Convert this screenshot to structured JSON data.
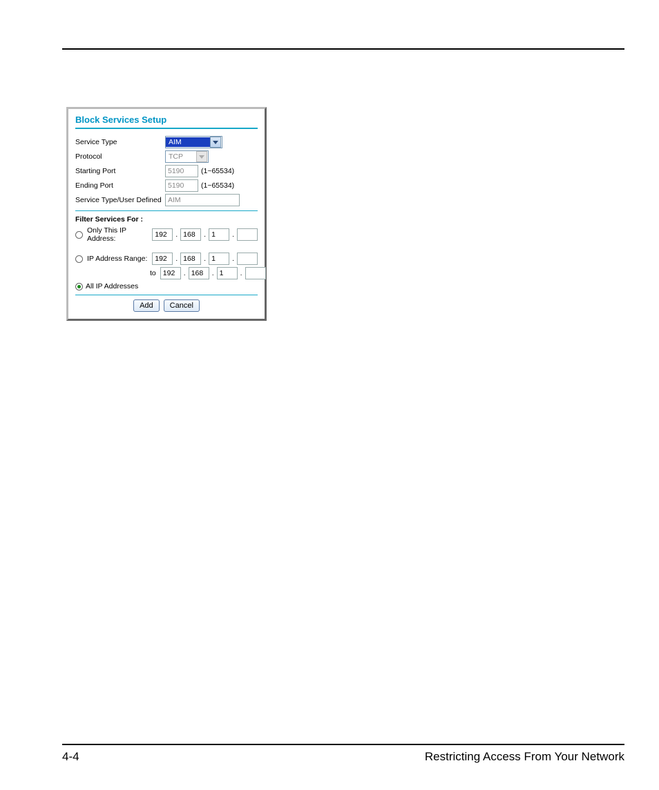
{
  "panel": {
    "title": "Block Services Setup",
    "fields": {
      "service_type_label": "Service Type",
      "service_type_value": "AIM",
      "protocol_label": "Protocol",
      "protocol_value": "TCP",
      "starting_port_label": "Starting Port",
      "starting_port_value": "5190",
      "starting_port_hint": "(1~65534)",
      "ending_port_label": "Ending Port",
      "ending_port_value": "5190",
      "ending_port_hint": "(1~65534)",
      "user_defined_label": "Service Type/User Defined",
      "user_defined_value": "AIM"
    },
    "filter": {
      "heading": "Filter Services For :",
      "only_label": "Only This IP Address:",
      "only_ip": {
        "a": "192",
        "b": "168",
        "c": "1",
        "d": ""
      },
      "range_label": "IP Address Range:",
      "range_to_label": "to",
      "range_from": {
        "a": "192",
        "b": "168",
        "c": "1",
        "d": ""
      },
      "range_to": {
        "a": "192",
        "b": "168",
        "c": "1",
        "d": ""
      },
      "all_label": "All IP Addresses",
      "selected": "all"
    },
    "buttons": {
      "add": "Add",
      "cancel": "Cancel"
    },
    "dot": "."
  },
  "footer": {
    "page_num": "4-4",
    "section": "Restricting Access From Your Network"
  }
}
